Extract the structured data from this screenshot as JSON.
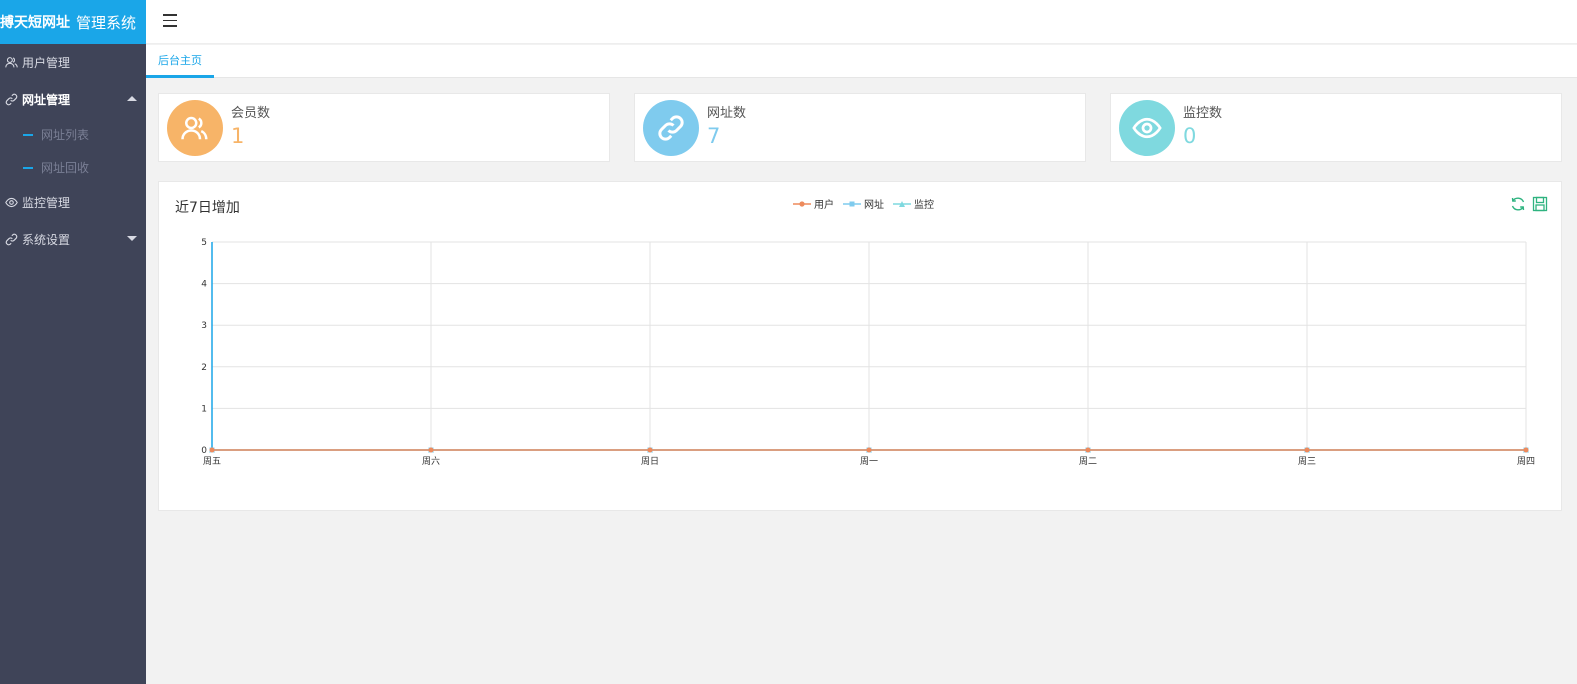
{
  "app": {
    "title_bold": "搏天短网址",
    "title_light": "管理系统"
  },
  "sidebar": {
    "items": [
      {
        "label": "用户管理",
        "icon": "users-icon"
      },
      {
        "label": "网址管理",
        "icon": "link-icon"
      },
      {
        "label": "监控管理",
        "icon": "eye-icon"
      },
      {
        "label": "系统设置",
        "icon": "link-icon"
      }
    ],
    "sub_items": [
      {
        "label": "网址列表"
      },
      {
        "label": "网址回收"
      }
    ]
  },
  "tabs": [
    {
      "label": "后台主页"
    }
  ],
  "stats": [
    {
      "title": "会员数",
      "value": "1",
      "icon": "users-icon",
      "color": "#f7b468"
    },
    {
      "title": "网址数",
      "value": "7",
      "icon": "link-icon",
      "color": "#7fcbee"
    },
    {
      "title": "监控数",
      "value": "0",
      "icon": "eye-icon",
      "color": "#7fd9df"
    }
  ],
  "panel": {
    "title": "近7日增加"
  },
  "colors": {
    "accent": "#1aa6e8",
    "sidebar": "#3f4458",
    "user_series": "#ed8a5c",
    "url_series": "#7fcbee",
    "monitor_series": "#7fd9df"
  },
  "chart_data": {
    "type": "line",
    "categories": [
      "周五",
      "周六",
      "周日",
      "周一",
      "周二",
      "周三",
      "周四"
    ],
    "series": [
      {
        "name": "用户",
        "values": [
          0,
          0,
          0,
          0,
          0,
          0,
          0
        ],
        "color": "#ed8a5c"
      },
      {
        "name": "网址",
        "values": [
          0,
          0,
          0,
          0,
          0,
          0,
          0
        ],
        "color": "#7fcbee"
      },
      {
        "name": "监控",
        "values": [
          0,
          0,
          0,
          0,
          0,
          0,
          0
        ],
        "color": "#7fd9df"
      }
    ],
    "ylim": [
      0,
      5
    ],
    "yticks": [
      "0",
      "1",
      "2",
      "3",
      "4",
      "5"
    ],
    "grid": true,
    "legend": "top-center"
  }
}
